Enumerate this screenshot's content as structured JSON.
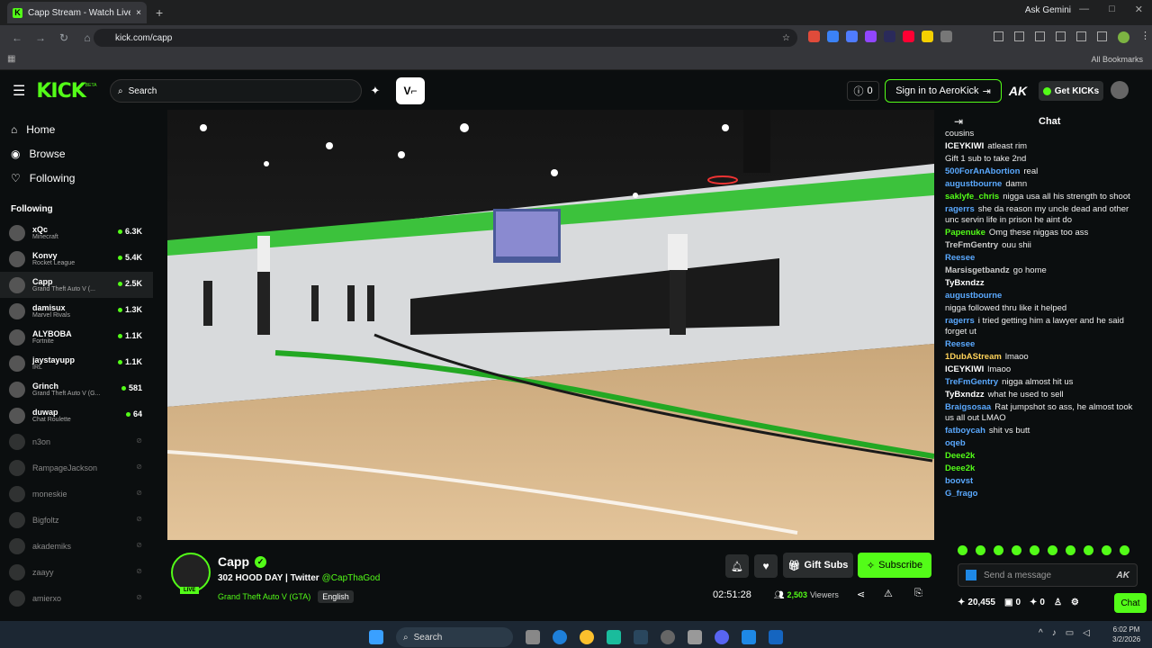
{
  "browser": {
    "tab_title": "Capp Stream - Watch Live ...",
    "tab_close": "×",
    "new_tab": "+",
    "gemini": "Ask Gemini",
    "url": "kick.com/capp",
    "all_bookmarks": "All Bookmarks",
    "window_controls": [
      "—",
      "□",
      "✕"
    ]
  },
  "header": {
    "logo": "KICK",
    "logo_beta": "BETA",
    "search_placeholder": "Search",
    "points": "0",
    "sign_in": "Sign in to AeroKick",
    "ak": "AK",
    "get_kicks": "Get KICKs"
  },
  "sidebar": {
    "nav": [
      {
        "label": "Home",
        "icon": "home-icon"
      },
      {
        "label": "Browse",
        "icon": "compass-icon"
      },
      {
        "label": "Following",
        "icon": "heart-icon"
      }
    ],
    "following_heading": "Following",
    "channels": [
      {
        "name": "xQc",
        "game": "Minecraft",
        "viewers": "6.3K",
        "live": true
      },
      {
        "name": "Konvy",
        "game": "Rocket League",
        "viewers": "5.4K",
        "live": true
      },
      {
        "name": "Capp",
        "game": "Grand Theft Auto V (...",
        "viewers": "2.5K",
        "live": true
      },
      {
        "name": "damisux",
        "game": "Marvel Rivals",
        "viewers": "1.3K",
        "live": true
      },
      {
        "name": "ALYBOBA",
        "game": "Fortnite",
        "viewers": "1.1K",
        "live": true
      },
      {
        "name": "jaystayupp",
        "game": "IRL",
        "viewers": "1.1K",
        "live": true
      },
      {
        "name": "Grinch",
        "game": "Grand Theft Auto V (G...",
        "viewers": "581",
        "live": true
      },
      {
        "name": "duwap",
        "game": "Chat Roulette",
        "viewers": "64",
        "live": true
      },
      {
        "name": "n3on",
        "live": false
      },
      {
        "name": "RampageJackson",
        "live": false
      },
      {
        "name": "moneskie",
        "live": false
      },
      {
        "name": "Bigfoltz",
        "live": false
      },
      {
        "name": "akademiks",
        "live": false
      },
      {
        "name": "zaayy",
        "live": false
      },
      {
        "name": "amierxo",
        "live": false
      }
    ]
  },
  "stream": {
    "name": "Capp",
    "title": "302 HOOD DAY | Twitter",
    "twitter": "@CapThaGod",
    "category": "Grand Theft Auto V (GTA)",
    "language": "English",
    "live_badge": "LIVE",
    "uptime": "02:51:28",
    "viewers": "2,503",
    "viewers_label": "Viewers",
    "gift_subs": "Gift Subs",
    "subscribe": "Subscribe"
  },
  "chat": {
    "title": "Chat",
    "messages": [
      {
        "user": "",
        "text": "cousins",
        "ucolor": "#ffffff"
      },
      {
        "user": "ICEYKIWI",
        "text": "atleast rim",
        "ucolor": "#ffffff"
      },
      {
        "user": "",
        "text": "Gift 1 sub to take 2nd",
        "ucolor": "#cccccc"
      },
      {
        "user": "500ForAnAbortion",
        "text": "real",
        "ucolor": "#5aa9ff"
      },
      {
        "user": "augustbourne",
        "text": "damn",
        "ucolor": "#5aa9ff"
      },
      {
        "user": "saklyfe_chris",
        "text": "nigga usa all his strength to shoot",
        "ucolor": "#53fc18"
      },
      {
        "user": "ragerrs",
        "text": "she da reason my uncle dead and other unc servin life in prison he aint do",
        "ucolor": "#5aa9ff"
      },
      {
        "user": "Papenuke",
        "text": "Omg these niggas too ass",
        "ucolor": "#53fc18"
      },
      {
        "user": "TreFmGentry",
        "text": "ouu shii",
        "ucolor": "#cccccc"
      },
      {
        "user": "Reesee",
        "text": "",
        "ucolor": "#5aa9ff"
      },
      {
        "user": "Marsisgetbandz",
        "text": "go home",
        "ucolor": "#cccccc"
      },
      {
        "user": "TyBxndzz",
        "text": "",
        "ucolor": "#ffffff"
      },
      {
        "user": "augustbourne",
        "text": "",
        "ucolor": "#5aa9ff"
      },
      {
        "user": "",
        "text": "nigga followed thru like it helped",
        "ucolor": "#cccccc"
      },
      {
        "user": "ragerrs",
        "text": "i tried getting him a lawyer and he said forget ut",
        "ucolor": "#5aa9ff"
      },
      {
        "user": "Reesee",
        "text": "",
        "ucolor": "#5aa9ff"
      },
      {
        "user": "1DubAStream",
        "text": "lmaoo",
        "ucolor": "#ffd35a"
      },
      {
        "user": "ICEYKIWI",
        "text": "lmaoo",
        "ucolor": "#ffffff"
      },
      {
        "user": "TreFmGentry",
        "text": "nigga almost hit us",
        "ucolor": "#5aa9ff"
      },
      {
        "user": "TyBxndzz",
        "text": "what he used to sell",
        "ucolor": "#ffffff"
      },
      {
        "user": "Braigsosaa",
        "text": "Rat jumpshot so ass, he almost took us all out LMAO",
        "ucolor": "#5aa9ff"
      },
      {
        "user": "fatboycah",
        "text": "shit vs butt",
        "ucolor": "#5aa9ff"
      },
      {
        "user": "oqeb",
        "text": "",
        "ucolor": "#5aa9ff"
      },
      {
        "user": "Deee2k",
        "text": "",
        "ucolor": "#53fc18"
      },
      {
        "user": "Deee2k",
        "text": "",
        "ucolor": "#53fc18"
      },
      {
        "user": "boovst",
        "text": "",
        "ucolor": "#5aa9ff"
      },
      {
        "user": "G_frago",
        "text": "",
        "ucolor": "#5aa9ff"
      }
    ],
    "input_placeholder": "Send a message",
    "points": "20,455",
    "count1": "0",
    "count2": "0",
    "chat_button": "Chat"
  },
  "taskbar": {
    "search": "Search",
    "time": "6:02 PM",
    "date": "3/2/2026"
  }
}
